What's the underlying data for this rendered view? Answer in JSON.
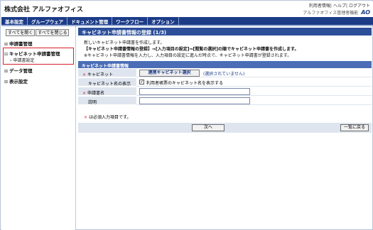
{
  "header": {
    "company": "株式会社 アルファオフィス",
    "links": [
      "利用者情報",
      "ヘルプ",
      "ログアウト"
    ],
    "system_name": "アルファオフィス管理者機能",
    "logo_text": "AO"
  },
  "menu": [
    "基本設定",
    "グループウェア",
    "ドキュメント管理",
    "ワークフロー",
    "オプション"
  ],
  "sidebar": {
    "open_all": "すべてを開く",
    "close_all": "すべてを閉じる",
    "items": [
      {
        "label": "申請書管理"
      },
      {
        "label": "キャビネット申請書管理"
      },
      {
        "label": "申請書設定"
      },
      {
        "label": "データ管理"
      },
      {
        "label": "表示設定"
      }
    ]
  },
  "main": {
    "title": "キャビネット申請書情報の登録 (1/3)",
    "desc1": "新しいキャビネット申請書を作成します。",
    "desc2": "【キャビネット申請書情報の登録】⇒[入力項目の設定]⇒[閲覧の選択]の順でキャビネット申請書を作成します。",
    "desc3": "※キャビネット申請書情報を入力し、入力項目の設定に進んだ時点で、キャビネット申請書が登録されます。",
    "section": "キャビネット申請書情報",
    "fields": {
      "cabinet_label": "キャビネット",
      "cabinet_button": "連携キャビネット選択",
      "cabinet_status": "(選択されていません)",
      "display_label": "キャビネット名の表示",
      "display_check": "利用者帳票のキャビネット名を表示する",
      "name_label": "申請書名",
      "desc_label": "説明"
    },
    "note": "は必須入力項目です。",
    "next_button": "次へ",
    "back_button": "一覧に戻る"
  },
  "colors": {
    "menubar": "#1c3c88",
    "title_bar": "#2d4f9a",
    "section_bar": "#4a6db6",
    "label_bg": "#dfe5ef",
    "required": "#d81e2a"
  }
}
